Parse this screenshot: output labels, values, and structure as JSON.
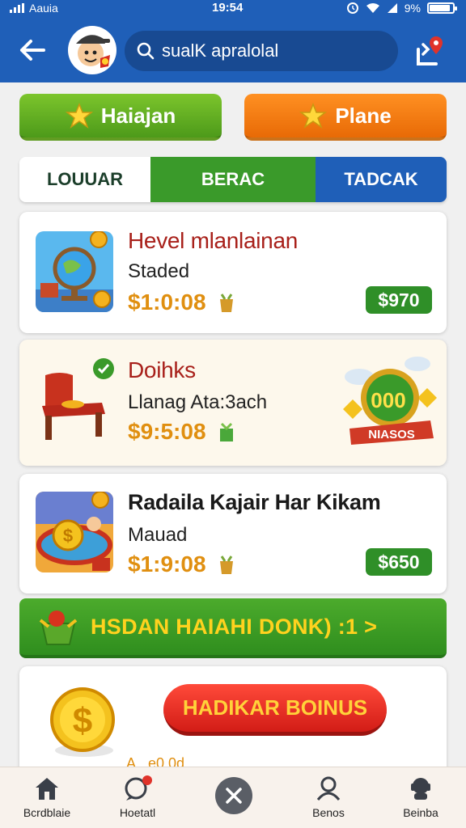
{
  "status_bar": {
    "carrier": "Aauia",
    "time": "19:54",
    "battery": "9%"
  },
  "header": {
    "search_text": "sualK apralolal",
    "icons": [
      "back-arrow-icon",
      "avatar-icon",
      "search-icon",
      "location-pin-icon"
    ]
  },
  "buttons": {
    "green_label": "Haiajan",
    "orange_label": "Plane"
  },
  "tabs": [
    {
      "label": "LOUUAR"
    },
    {
      "label": "BERAC"
    },
    {
      "label": "TADCAK"
    }
  ],
  "items": [
    {
      "title": "Hevel mlanlainan",
      "subtitle": "Staded",
      "price": "$1:0:08",
      "badge": "$970"
    },
    {
      "title": "Doihks",
      "subtitle": "Llanag Ata:3ach",
      "price": "$9:5:08",
      "badge_text": "000",
      "ribbon_text": "NIASOS"
    },
    {
      "title": "Radaila Kajair Har Kikam",
      "subtitle": "Mauad",
      "price": "$1:9:08",
      "badge": "$650"
    }
  ],
  "banner": {
    "text": "HSDAN HAIAHI DONK) :1 >"
  },
  "bonus": {
    "button_label": "HADIKAR BOINUS",
    "partial_text": "A...e0 0d"
  },
  "bottom_nav": [
    {
      "label": "Bcrdblaie",
      "icon": "home-icon"
    },
    {
      "label": "Hoetatl",
      "icon": "chat-notify-icon"
    },
    {
      "label": "",
      "icon": "close-icon"
    },
    {
      "label": "Benos",
      "icon": "user-icon"
    },
    {
      "label": "Beinba",
      "icon": "support-icon"
    }
  ],
  "colors": {
    "primary_blue": "#1f5fb8",
    "green": "#3a9a2a",
    "orange": "#ff8a1a",
    "red": "#d21c16",
    "gold": "#e08f10"
  }
}
